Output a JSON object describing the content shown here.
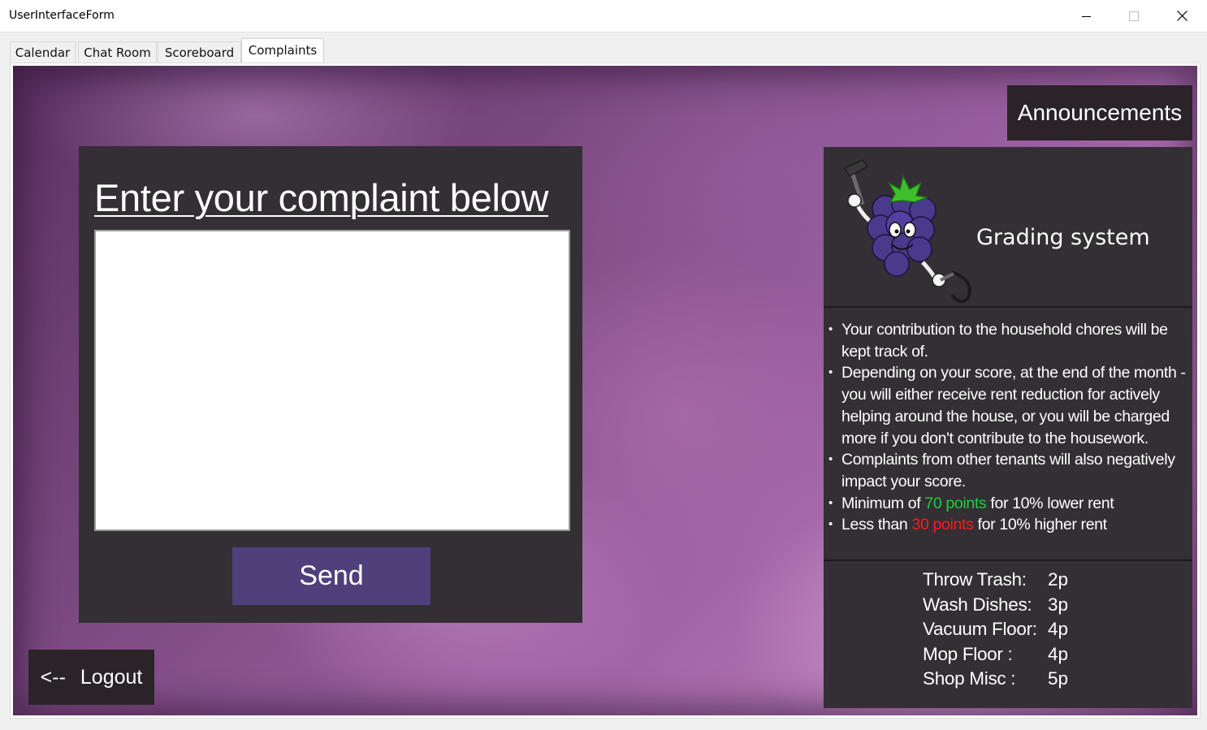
{
  "window": {
    "title": "UserInterfaceForm"
  },
  "tabs": [
    {
      "label": "Calendar"
    },
    {
      "label": "Chat Room"
    },
    {
      "label": "Scoreboard"
    },
    {
      "label": "Complaints",
      "selected": true
    }
  ],
  "complaint": {
    "heading": "Enter your complaint below",
    "input_value": "",
    "send_label": "Send"
  },
  "logout": {
    "arrow": "<--",
    "label": "Logout"
  },
  "announcements": {
    "label": "Announcements"
  },
  "grading": {
    "title": "Grading system",
    "mascot_icon": "blackberry-mascot-with-hammer-and-sickle",
    "rules": [
      {
        "text": "Your contribution to the household  chores will be kept track of."
      },
      {
        "text": "Depending on your score, at the end of the month - you will either receive rent reduction for actively helping around the house, or you will be charged more if you don't contribute to the housework."
      },
      {
        "text": "Complaints from other tenants will also negatively impact your score."
      }
    ],
    "min_rule": {
      "prefix": "Minimum of ",
      "highlight": "70 points",
      "suffix": " for 10% lower rent"
    },
    "max_rule": {
      "prefix": "Less than ",
      "highlight": "30 points",
      "suffix": " for 10% higher rent"
    },
    "point_values": [
      {
        "task": "Throw Trash:",
        "points": "2p"
      },
      {
        "task": "Wash Dishes:",
        "points": "3p"
      },
      {
        "task": "Vacuum Floor:",
        "points": "4p"
      },
      {
        "task": "Mop Floor :",
        "points": "4p"
      },
      {
        "task": "Shop Misc :",
        "points": "5p"
      }
    ]
  },
  "colors": {
    "panel_bg": "#342e35",
    "send_button": "#4f3f7b",
    "dark_button": "#2a2429",
    "highlight_green": "#19d23c",
    "highlight_red": "#ff1a1a"
  }
}
